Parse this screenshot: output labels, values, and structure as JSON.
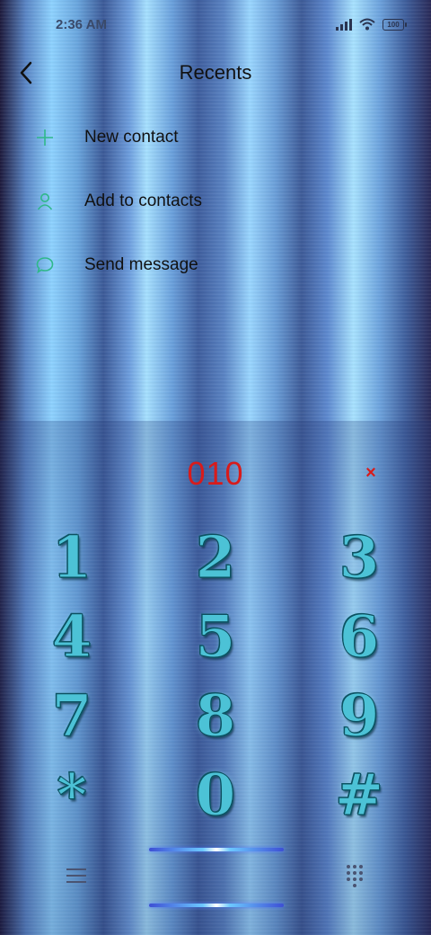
{
  "status_bar": {
    "time": "2:36 AM",
    "battery": "100"
  },
  "header": {
    "title": "Recents"
  },
  "menu": [
    {
      "label": "New contact",
      "icon": "plus-icon"
    },
    {
      "label": "Add to contacts",
      "icon": "person-icon"
    },
    {
      "label": "Send message",
      "icon": "chat-bubble-icon"
    }
  ],
  "dialer": {
    "number": "010",
    "clear_symbol": "×",
    "keys": [
      "1",
      "2",
      "3",
      "4",
      "5",
      "6",
      "7",
      "8",
      "9",
      "*",
      "0",
      "#"
    ]
  },
  "colors": {
    "accent_green": "#2fb88a",
    "number_red": "#d81b1b",
    "key_teal": "#4cc2d6"
  }
}
